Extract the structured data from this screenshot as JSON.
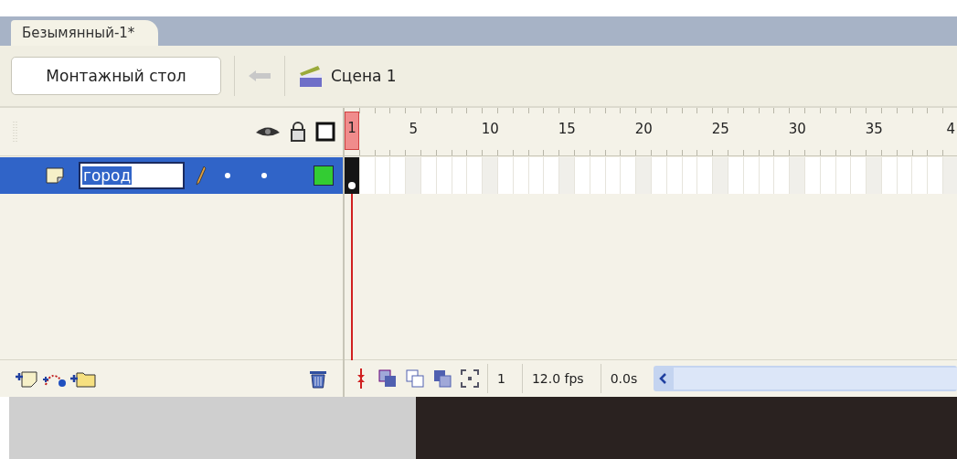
{
  "tabs": [
    {
      "label": "Безымянный-1*",
      "selected": true
    }
  ],
  "toolbar": {
    "timeline_button": "Монтажный стол",
    "scene": "Сцена 1"
  },
  "ruler": [
    "1",
    "5",
    "10",
    "15",
    "20",
    "25",
    "30",
    "35",
    "4"
  ],
  "layers": [
    {
      "name": "город",
      "selected": true,
      "color": "#33cc33"
    }
  ],
  "status": {
    "frame": "1",
    "fps": "12.0 fps",
    "time": "0.0s"
  }
}
